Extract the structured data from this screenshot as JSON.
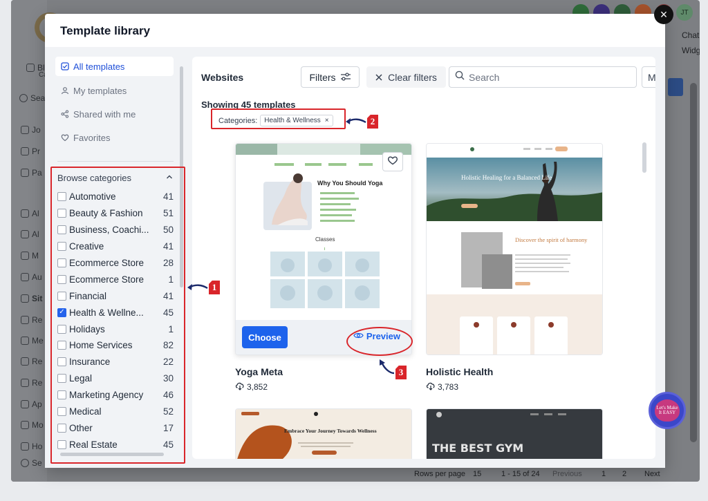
{
  "modal": {
    "title": "Template library",
    "close_icon": "×"
  },
  "nav": [
    {
      "label": "All templates",
      "icon": "checkbox-icon",
      "active": true
    },
    {
      "label": "My templates",
      "icon": "user-icon"
    },
    {
      "label": "Shared with me",
      "icon": "share-icon"
    },
    {
      "label": "Favorites",
      "icon": "heart-icon"
    }
  ],
  "categories_header": "Browse categories",
  "categories": [
    {
      "name": "Automotive",
      "count": "41",
      "checked": false
    },
    {
      "name": "Beauty & Fashion",
      "count": "51",
      "checked": false
    },
    {
      "name": "Business, Coachi...",
      "count": "50",
      "checked": false
    },
    {
      "name": "Creative",
      "count": "41",
      "checked": false
    },
    {
      "name": "Ecommerce Store",
      "count": "28",
      "checked": false
    },
    {
      "name": "Ecommerce Store",
      "count": "1",
      "checked": false
    },
    {
      "name": "Financial",
      "count": "41",
      "checked": false
    },
    {
      "name": "Health & Wellne...",
      "count": "45",
      "checked": true
    },
    {
      "name": "Holidays",
      "count": "1",
      "checked": false
    },
    {
      "name": "Home Services",
      "count": "82",
      "checked": false
    },
    {
      "name": "Insurance",
      "count": "22",
      "checked": false
    },
    {
      "name": "Legal",
      "count": "30",
      "checked": false
    },
    {
      "name": "Marketing Agency",
      "count": "46",
      "checked": false
    },
    {
      "name": "Medical",
      "count": "52",
      "checked": false
    },
    {
      "name": "Other",
      "count": "17",
      "checked": false
    },
    {
      "name": "Real Estate",
      "count": "45",
      "checked": false
    }
  ],
  "toolbar": {
    "title": "Websites",
    "filters_label": "Filters",
    "clear_label": "Clear filters",
    "search_placeholder": "Search",
    "more_label": "M"
  },
  "results": {
    "showing": "Showing 45 templates",
    "categories_label": "Categories:",
    "active_chip": "Health & Wellness",
    "chip_remove": "×"
  },
  "cards": [
    {
      "name": "Yoga Meta",
      "downloads": "3,852",
      "choose_label": "Choose",
      "preview_label": "Preview",
      "thumb": {
        "heading": "Why You Should Yoga",
        "section": "Classes"
      }
    },
    {
      "name": "Holistic Health",
      "downloads": "3,783",
      "thumb": {
        "hero": "Holistic Healing for a Balanced Life",
        "headline": "Discover the spirit of harmony"
      }
    },
    {
      "thumb": {
        "headline": "Embrace Your Journey Towards Wellness"
      }
    },
    {
      "thumb": {
        "headline": "THE BEST GYM"
      }
    }
  ],
  "annotations": [
    "1",
    "2",
    "3"
  ],
  "badge_text": "Let's Make It EASY",
  "background": {
    "right_labels": [
      "Chat",
      "Widg"
    ],
    "sidebar_labels": [
      "Bl",
      "Ca",
      "Sea",
      "Jo",
      "Pr",
      "Pa",
      "Al",
      "Al",
      "M",
      "Au",
      "Sit",
      "Re",
      "Me",
      "Re",
      "Re",
      "Ap",
      "Mo",
      "Ho",
      "Se"
    ],
    "avatar_initials": "JT",
    "pagination": {
      "rows_label": "Rows per page",
      "rows_value": "15",
      "range": "1 - 15 of 24",
      "previous": "Previous",
      "pages": [
        "1",
        "2"
      ],
      "next": "Next"
    }
  },
  "colors": {
    "accent": "#1d63ec",
    "annotation": "#d9252a",
    "overlay": "#7d7f83"
  }
}
